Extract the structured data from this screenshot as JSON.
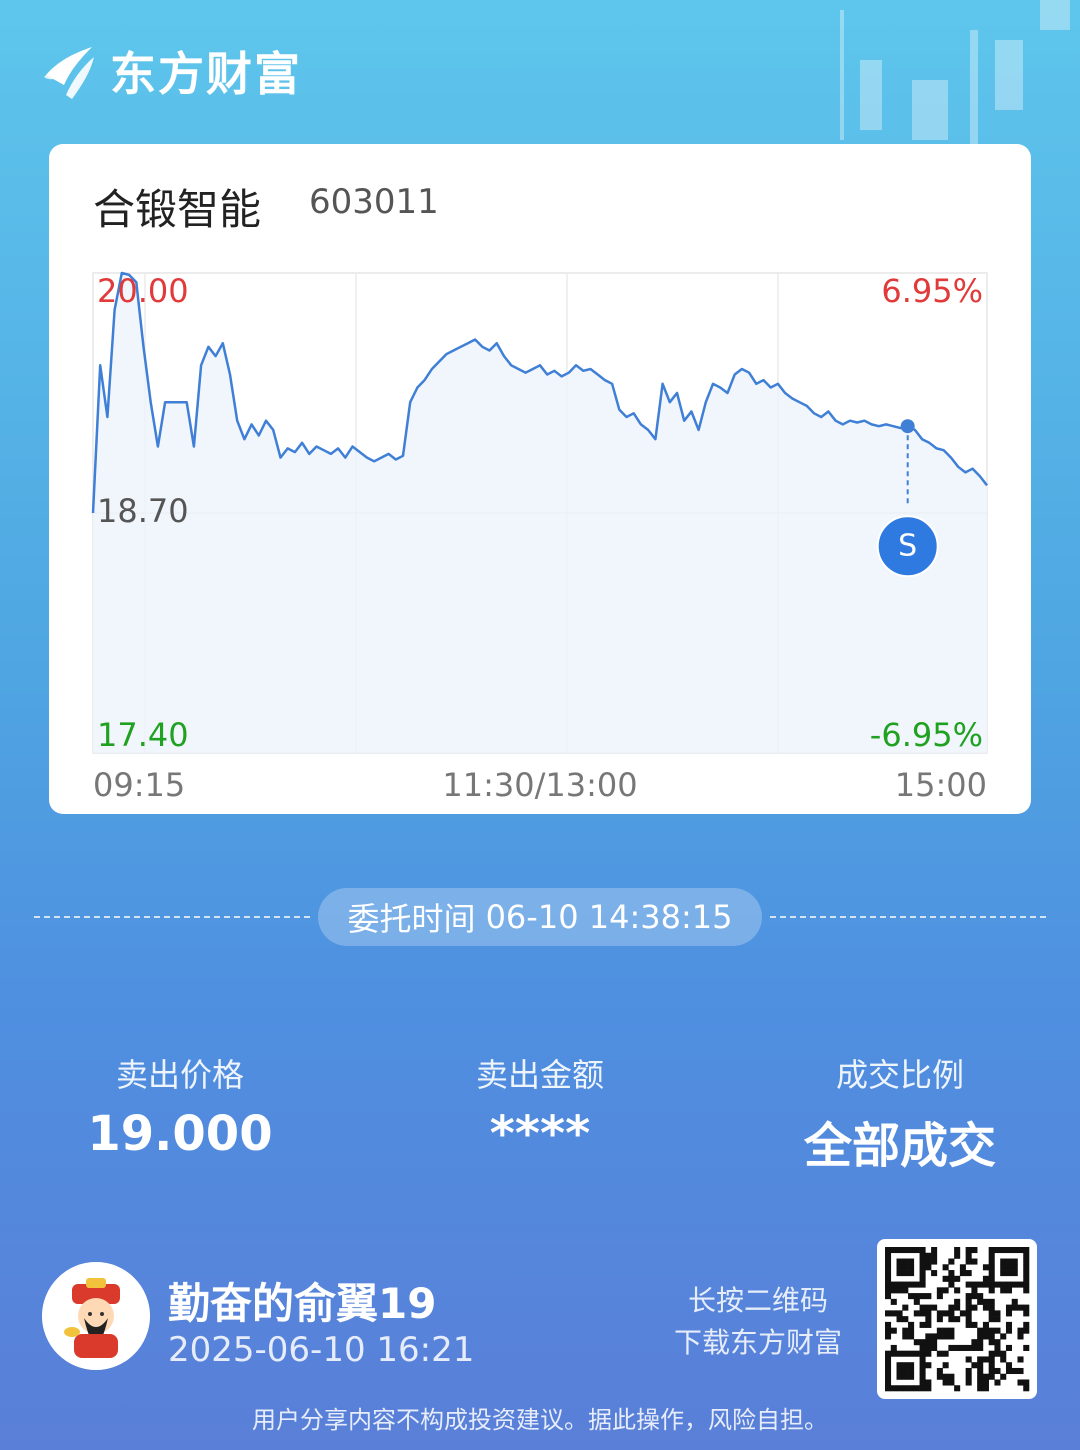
{
  "brand": {
    "name": "东方财富"
  },
  "stock": {
    "name": "合锻智能",
    "code": "603011"
  },
  "chart_data": {
    "type": "line",
    "price_top": "20.00",
    "price_mid": "18.70",
    "price_bottom": "17.40",
    "pct_top": "6.95%",
    "pct_bottom": "-6.95%",
    "ylim": [
      17.4,
      20.0
    ],
    "x_ticks": [
      "09:15",
      "11:30/13:00",
      "15:00"
    ],
    "marker": {
      "label": "S",
      "time": "14:38",
      "price": 19.0
    },
    "series": [
      {
        "values": [
          18.7,
          19.5,
          19.22,
          19.8,
          20.0,
          19.99,
          19.95,
          19.6,
          19.3,
          19.06,
          19.3,
          19.3,
          19.3,
          19.3,
          19.06,
          19.5,
          19.6,
          19.55,
          19.62,
          19.45,
          19.2,
          19.1,
          19.18,
          19.12,
          19.2,
          19.15,
          19.0,
          19.05,
          19.03,
          19.08,
          19.02,
          19.06,
          19.04,
          19.02,
          19.05,
          19.0,
          19.06,
          19.03,
          19.0,
          18.98,
          19.0,
          19.02,
          18.99,
          19.01,
          19.3,
          19.38,
          19.42,
          19.48,
          19.52,
          19.56,
          19.58,
          19.6,
          19.62,
          19.64,
          19.6,
          19.58,
          19.62,
          19.55,
          19.5,
          19.48,
          19.46,
          19.48,
          19.5,
          19.45,
          19.47,
          19.44,
          19.46,
          19.5,
          19.47,
          19.48,
          19.45,
          19.42,
          19.4,
          19.26,
          19.22,
          19.24,
          19.18,
          19.15,
          19.1,
          19.4,
          19.3,
          19.35,
          19.2,
          19.25,
          19.15,
          19.3,
          19.4,
          19.38,
          19.35,
          19.45,
          19.48,
          19.46,
          19.4,
          19.42,
          19.38,
          19.4,
          19.35,
          19.32,
          19.3,
          19.28,
          19.24,
          19.22,
          19.25,
          19.2,
          19.18,
          19.2,
          19.19,
          19.2,
          19.18,
          19.17,
          19.18,
          19.17,
          19.16,
          19.17,
          19.15,
          19.1,
          19.08,
          19.05,
          19.04,
          19.0,
          18.95,
          18.92,
          18.94,
          18.9,
          18.85
        ]
      }
    ]
  },
  "order": {
    "time_label": "委托时间",
    "time_value": "06-10 14:38:15"
  },
  "stats": {
    "sell_price_label": "卖出价格",
    "sell_price_value": "19.000",
    "sell_amount_label": "卖出金额",
    "sell_amount_value": "****",
    "fill_ratio_label": "成交比例",
    "fill_ratio_value": "全部成交"
  },
  "user": {
    "name": "勤奋的俞翼19",
    "datetime": "2025-06-10 16:21"
  },
  "qr_hint": {
    "line1": "长按二维码",
    "line2": "下载东方财富"
  },
  "disclaimer": "用户分享内容不构成投资建议。据此操作，风险自担。",
  "colors": {
    "up": "#e03a3a",
    "down": "#21a121",
    "line": "#3f7fd6",
    "accent": "#2f7ae0"
  }
}
